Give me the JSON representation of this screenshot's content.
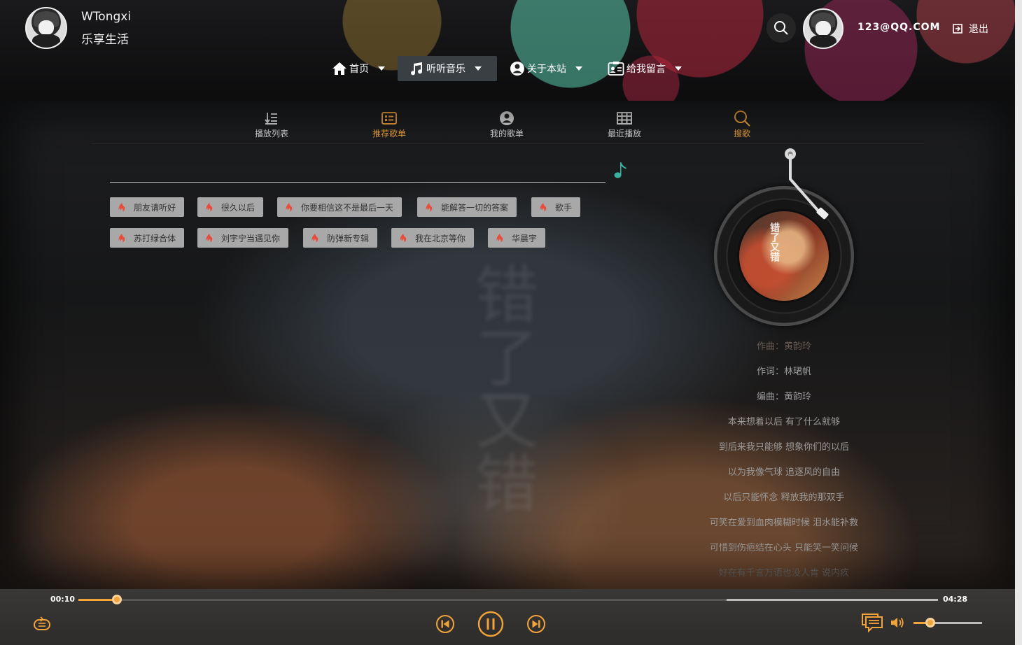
{
  "header": {
    "site_name": "WTongxi",
    "slogan": "乐享生活",
    "user_email": "123@QQ.COM",
    "logout_label": "退出"
  },
  "nav": {
    "items": [
      {
        "label": "首页",
        "icon": "home-icon"
      },
      {
        "label": "听听音乐",
        "icon": "music-icon",
        "active": true
      },
      {
        "label": "关于本站",
        "icon": "user-circle-icon"
      },
      {
        "label": "给我留言",
        "icon": "contact-card-icon"
      }
    ]
  },
  "tabs": [
    {
      "label": "播放列表",
      "icon": "playlist-icon"
    },
    {
      "label": "推荐歌单",
      "icon": "recommend-list-icon",
      "active": true
    },
    {
      "label": "我的歌单",
      "icon": "user-icon"
    },
    {
      "label": "最近播放",
      "icon": "grid-icon"
    },
    {
      "label": "搜歌",
      "icon": "search-icon",
      "active": true
    }
  ],
  "search": {
    "value": "",
    "placeholder": ""
  },
  "hot_tags": [
    "朋友请听好",
    "很久以后",
    "你要相信这不是最后一天",
    "能解答一切的答案",
    "歌手",
    "苏打绿合体",
    "刘宇宁当遇见你",
    "防弹新专辑",
    "我在北京等你",
    "华晨宇"
  ],
  "album_cover_text": "错了又错",
  "lyrics": [
    "作曲：黄韵玲",
    "作词：林珺帆",
    "编曲：黄韵玲",
    "本来想着以后 有了什么就够",
    "到后来我只能够 想象你们的以后",
    "以为我像气球 追逐风的自由",
    "以后只能怀念 释放我的那双手",
    "可笑在爱到血肉模糊时候 泪水能补救",
    "可惜到伤疤结在心头 只能笑一笑问候",
    "好在有千言万语也没人肯 说内疚"
  ],
  "player": {
    "current_time": "00:10",
    "total_time": "04:28",
    "progress": 0.045,
    "buffered_from": 0.754,
    "volume": 0.24
  },
  "colors": {
    "accent": "#f2a33a",
    "tag_bg": "#a8a8a8",
    "fire": "#e74c3c",
    "note": "#3bb0a0"
  }
}
